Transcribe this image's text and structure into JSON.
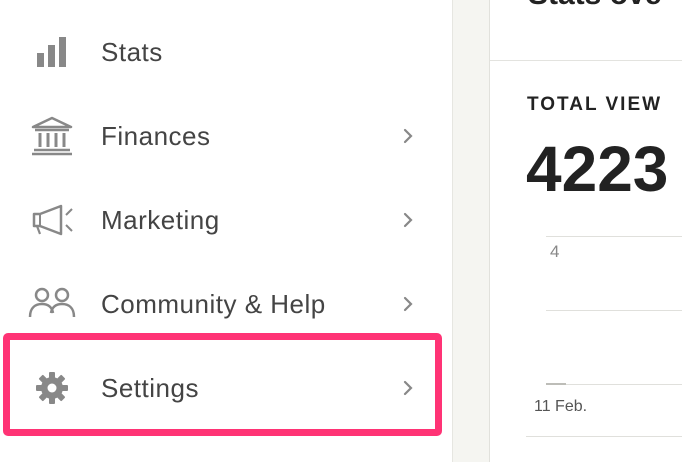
{
  "sidebar": {
    "items": [
      {
        "label": "Stats",
        "icon": "bar-chart-icon",
        "has_chevron": false
      },
      {
        "label": "Finances",
        "icon": "bank-icon",
        "has_chevron": true
      },
      {
        "label": "Marketing",
        "icon": "megaphone-icon",
        "has_chevron": true
      },
      {
        "label": "Community & Help",
        "icon": "people-icon",
        "has_chevron": true
      },
      {
        "label": "Settings",
        "icon": "gear-icon",
        "has_chevron": true,
        "highlighted": true
      }
    ],
    "highlight_color": "#ff3375"
  },
  "main": {
    "title": "Stats ove",
    "stat_label": "TOTAL VIEW",
    "stat_value": "4223",
    "chart": {
      "y_tick": "4",
      "x_label": "11 Feb."
    }
  }
}
